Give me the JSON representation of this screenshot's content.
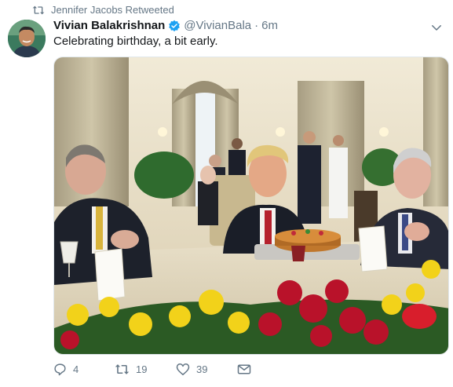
{
  "retweet": {
    "text": "Jennifer Jacobs Retweeted",
    "icon": "retweet-icon"
  },
  "tweet": {
    "display_name": "Vivian Balakrishnan",
    "handle": "@VivianBala",
    "separator": "·",
    "time": "6m",
    "text": "Celebrating birthday, a bit early.",
    "verified_color": "#1da1f2"
  },
  "actions": {
    "reply_count": "4",
    "retweet_count": "19",
    "like_count": "39"
  },
  "colors": {
    "secondary_text": "#657786",
    "primary_text": "#14171a"
  }
}
